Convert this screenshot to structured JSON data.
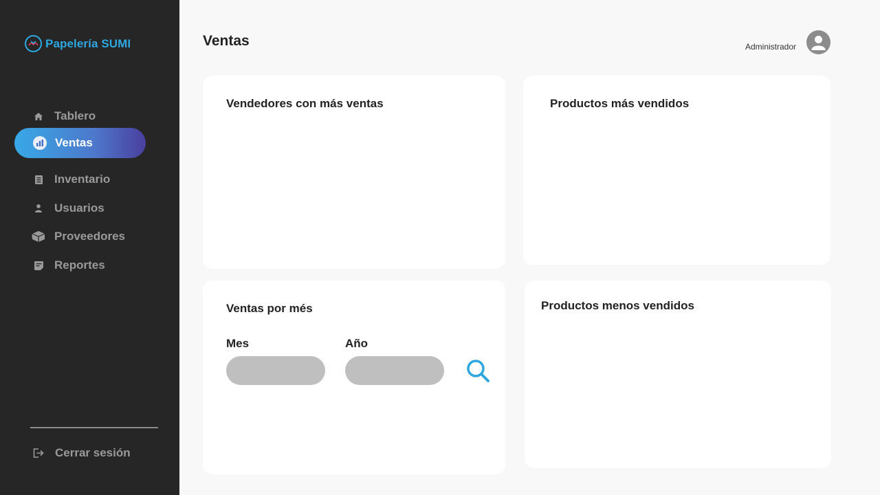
{
  "brand": {
    "name": "Papelería SUMI",
    "accent": "#2ea7e0"
  },
  "sidebar": {
    "items": [
      {
        "label": "Tablero",
        "icon": "home-icon"
      },
      {
        "label": "Ventas",
        "icon": "sales-chart-icon",
        "active": true
      },
      {
        "label": "Inventario",
        "icon": "clipboard-icon"
      },
      {
        "label": "Usuarios",
        "icon": "user-icon"
      },
      {
        "label": "Proveedores",
        "icon": "box-icon"
      },
      {
        "label": "Reportes",
        "icon": "report-icon"
      }
    ],
    "logout_label": "Cerrar sesión"
  },
  "header": {
    "title": "Ventas",
    "user_role": "Administrador"
  },
  "cards": {
    "top_sellers": {
      "title": "Vendedores con más ventas"
    },
    "top_products": {
      "title": "Productos más vendidos"
    },
    "monthly_sales": {
      "title": "Ventas por més",
      "month_label": "Mes",
      "month_value": "",
      "year_label": "Año",
      "year_value": ""
    },
    "least_products": {
      "title": "Productos menos vendidos"
    }
  },
  "colors": {
    "sidebar_bg": "#262626",
    "active_gradient_start": "#38a9e6",
    "active_gradient_end": "#4a3f9e",
    "field_bg": "#bfbfbf"
  }
}
